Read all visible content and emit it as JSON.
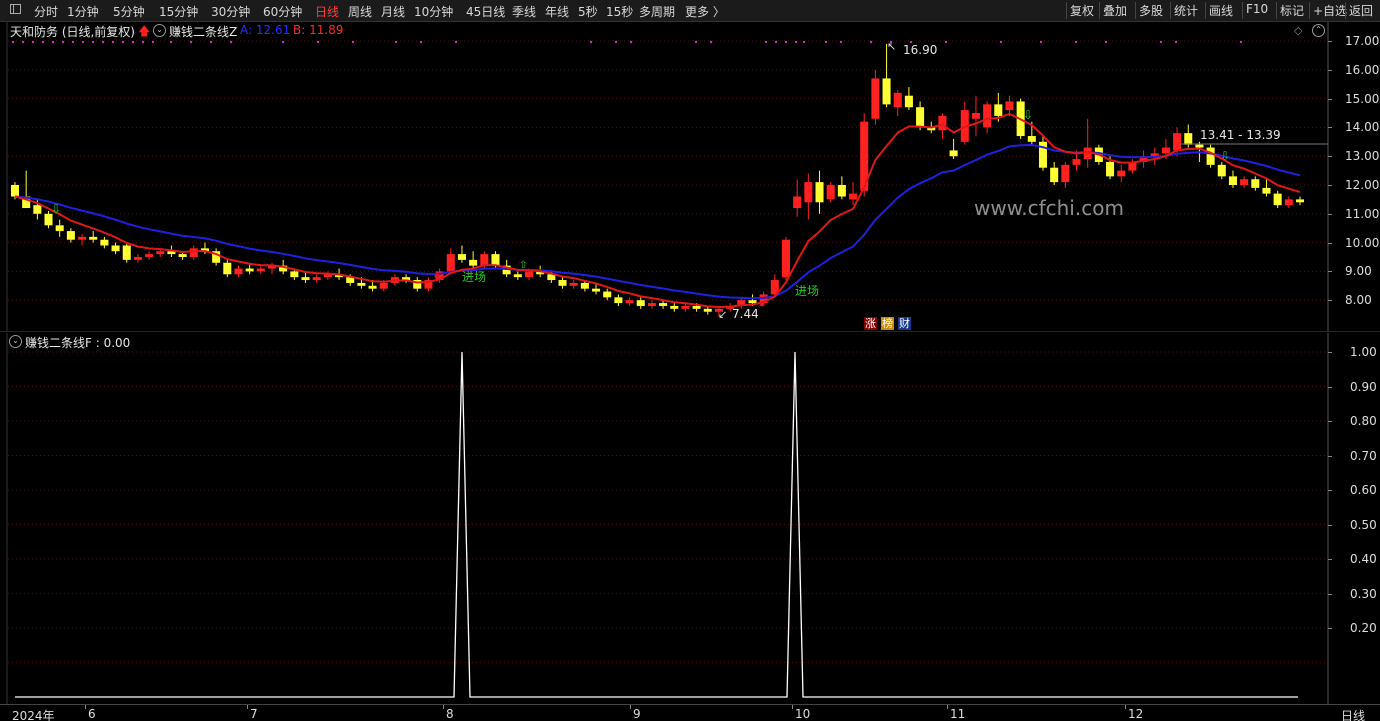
{
  "toolbar": {
    "periods": [
      "分时",
      "1分钟",
      "5分钟",
      "15分钟",
      "30分钟",
      "60分钟",
      "日线",
      "周线",
      "月线",
      "10分钟",
      "45日线",
      "季线",
      "年线",
      "5秒",
      "15秒",
      "多周期",
      "更多 〉"
    ],
    "active_period": "日线",
    "right_buttons": [
      "复权",
      "叠加",
      "多股",
      "统计",
      "画线",
      "F10",
      "标记",
      "+自选",
      "返回"
    ]
  },
  "main_header": {
    "stock_title": "天和防务 (日线,前复权)",
    "indicator_name": "赚钱二条线Z",
    "a_label": "A: 12.61",
    "b_label": "B: 11.89"
  },
  "sub_header": {
    "indicator_label": "赚钱二条线F : 0.00"
  },
  "annotations": {
    "high_label": "16.90",
    "low_label": "7.44",
    "range_label": "13.41 - 13.39",
    "entry_label_1": "进场",
    "entry_label_2": "进场",
    "watermark": "www.cfchi.com",
    "badge_1": "涨",
    "badge_2": "榜",
    "badge_3": "财"
  },
  "price_axis": [
    "17.00",
    "16.00",
    "15.00",
    "14.00",
    "13.00",
    "12.00",
    "11.00",
    "10.00",
    "9.00",
    "8.00"
  ],
  "indicator_axis": [
    "1.00",
    "0.90",
    "0.80",
    "0.70",
    "0.60",
    "0.50",
    "0.40",
    "0.30",
    "0.20"
  ],
  "date_axis": {
    "year_label": "2024年",
    "months": [
      "6",
      "7",
      "8",
      "9",
      "10",
      "11",
      "12"
    ],
    "period_label": "日线"
  },
  "colors": {
    "up_candle": "#ff2020",
    "down_candle": "#ffff33",
    "line_a": "#2020e0",
    "line_b": "#e01818",
    "signal_line": "#ffffff",
    "entry_text": "#22cc22",
    "marker_dots": "#cc33cc",
    "grid": "#3a0c0c"
  },
  "chart_data": [
    {
      "type": "candlestick",
      "title": "天和防务 (日线,前复权)",
      "series": [
        {
          "name": "A",
          "last": 12.61
        },
        {
          "name": "B",
          "last": 11.89
        }
      ],
      "ylim": [
        7.4,
        17.2
      ],
      "high": 16.9,
      "low": 7.44,
      "x_months": [
        "6",
        "7",
        "8",
        "9",
        "10",
        "11",
        "12"
      ],
      "candles_ohlc": [
        [
          12.0,
          12.1,
          11.5,
          11.6
        ],
        [
          11.6,
          12.5,
          11.4,
          11.2
        ],
        [
          11.3,
          11.5,
          10.8,
          11.0
        ],
        [
          11.0,
          11.1,
          10.5,
          10.6
        ],
        [
          10.6,
          10.8,
          10.2,
          10.4
        ],
        [
          10.4,
          10.5,
          10.0,
          10.1
        ],
        [
          10.1,
          10.3,
          9.9,
          10.2
        ],
        [
          10.2,
          10.4,
          10.0,
          10.1
        ],
        [
          10.1,
          10.2,
          9.8,
          9.9
        ],
        [
          9.9,
          10.0,
          9.6,
          9.7
        ],
        [
          9.9,
          10.0,
          9.3,
          9.4
        ],
        [
          9.4,
          9.6,
          9.3,
          9.5
        ],
        [
          9.5,
          9.7,
          9.4,
          9.6
        ],
        [
          9.6,
          9.8,
          9.5,
          9.7
        ],
        [
          9.7,
          9.9,
          9.5,
          9.6
        ],
        [
          9.6,
          9.7,
          9.4,
          9.5
        ],
        [
          9.5,
          9.9,
          9.4,
          9.8
        ],
        [
          9.8,
          10.0,
          9.6,
          9.7
        ],
        [
          9.7,
          9.8,
          9.2,
          9.3
        ],
        [
          9.3,
          9.4,
          8.8,
          8.9
        ],
        [
          8.9,
          9.2,
          8.8,
          9.1
        ],
        [
          9.1,
          9.3,
          8.9,
          9.0
        ],
        [
          9.0,
          9.2,
          8.9,
          9.1
        ],
        [
          9.1,
          9.3,
          8.9,
          9.2
        ],
        [
          9.2,
          9.4,
          8.9,
          9.0
        ],
        [
          9.0,
          9.1,
          8.7,
          8.8
        ],
        [
          8.8,
          9.0,
          8.6,
          8.7
        ],
        [
          8.7,
          8.9,
          8.6,
          8.8
        ],
        [
          8.8,
          9.0,
          8.7,
          8.9
        ],
        [
          8.9,
          9.1,
          8.7,
          8.8
        ],
        [
          8.8,
          8.9,
          8.5,
          8.6
        ],
        [
          8.6,
          8.8,
          8.4,
          8.5
        ],
        [
          8.5,
          8.7,
          8.3,
          8.4
        ],
        [
          8.4,
          8.7,
          8.3,
          8.6
        ],
        [
          8.6,
          8.9,
          8.5,
          8.8
        ],
        [
          8.8,
          8.9,
          8.6,
          8.7
        ],
        [
          8.7,
          8.8,
          8.3,
          8.4
        ],
        [
          8.4,
          8.8,
          8.3,
          8.7
        ],
        [
          8.7,
          9.1,
          8.6,
          9.0
        ],
        [
          9.0,
          9.8,
          8.9,
          9.6
        ],
        [
          9.6,
          9.9,
          9.3,
          9.4
        ],
        [
          9.4,
          9.7,
          9.1,
          9.2
        ],
        [
          9.2,
          9.7,
          9.1,
          9.6
        ],
        [
          9.6,
          9.7,
          9.1,
          9.2
        ],
        [
          9.2,
          9.4,
          8.8,
          8.9
        ],
        [
          8.9,
          9.0,
          8.7,
          8.8
        ],
        [
          8.8,
          9.1,
          8.7,
          9.0
        ],
        [
          9.0,
          9.2,
          8.8,
          8.9
        ],
        [
          8.9,
          9.0,
          8.6,
          8.7
        ],
        [
          8.7,
          8.8,
          8.4,
          8.5
        ],
        [
          8.5,
          8.7,
          8.4,
          8.6
        ],
        [
          8.6,
          8.7,
          8.3,
          8.4
        ],
        [
          8.4,
          8.6,
          8.2,
          8.3
        ],
        [
          8.3,
          8.4,
          8.0,
          8.1
        ],
        [
          8.1,
          8.2,
          7.8,
          7.9
        ],
        [
          7.9,
          8.1,
          7.8,
          8.0
        ],
        [
          8.0,
          8.1,
          7.7,
          7.8
        ],
        [
          7.8,
          8.0,
          7.7,
          7.9
        ],
        [
          7.9,
          8.0,
          7.7,
          7.8
        ],
        [
          7.8,
          7.9,
          7.6,
          7.7
        ],
        [
          7.7,
          7.9,
          7.6,
          7.8
        ],
        [
          7.8,
          7.9,
          7.6,
          7.7
        ],
        [
          7.7,
          7.8,
          7.5,
          7.6
        ],
        [
          7.6,
          7.8,
          7.44,
          7.7
        ],
        [
          7.7,
          7.9,
          7.6,
          7.8
        ],
        [
          7.8,
          8.1,
          7.7,
          8.0
        ],
        [
          8.0,
          8.2,
          7.8,
          7.9
        ],
        [
          7.9,
          8.3,
          7.8,
          8.2
        ],
        [
          8.2,
          8.9,
          8.1,
          8.7
        ],
        [
          8.8,
          10.2,
          8.7,
          10.1
        ],
        [
          11.2,
          12.2,
          10.9,
          11.6
        ],
        [
          11.4,
          12.4,
          10.8,
          12.1
        ],
        [
          12.1,
          12.5,
          11.0,
          11.4
        ],
        [
          11.5,
          12.1,
          11.4,
          12.0
        ],
        [
          12.0,
          12.3,
          11.5,
          11.6
        ],
        [
          11.5,
          12.1,
          11.3,
          11.7
        ],
        [
          11.8,
          14.5,
          11.6,
          14.2
        ],
        [
          14.3,
          16.0,
          14.1,
          15.7
        ],
        [
          15.7,
          16.9,
          14.7,
          14.8
        ],
        [
          14.7,
          15.3,
          14.4,
          15.2
        ],
        [
          15.1,
          15.4,
          14.6,
          14.7
        ],
        [
          14.7,
          14.9,
          13.9,
          14.0
        ],
        [
          14.0,
          14.2,
          13.8,
          13.9
        ],
        [
          13.9,
          14.5,
          13.6,
          14.4
        ],
        [
          13.2,
          13.6,
          12.9,
          13.0
        ],
        [
          13.5,
          14.9,
          13.4,
          14.6
        ],
        [
          14.3,
          15.1,
          13.7,
          14.5
        ],
        [
          14.0,
          14.9,
          13.8,
          14.8
        ],
        [
          14.8,
          15.2,
          14.2,
          14.4
        ],
        [
          14.6,
          15.1,
          14.4,
          14.9
        ],
        [
          14.9,
          15.0,
          13.6,
          13.7
        ],
        [
          13.7,
          14.2,
          13.4,
          13.5
        ],
        [
          13.5,
          13.7,
          12.5,
          12.6
        ],
        [
          12.6,
          12.8,
          12.0,
          12.1
        ],
        [
          12.1,
          12.8,
          11.9,
          12.7
        ],
        [
          12.7,
          13.2,
          12.5,
          12.9
        ],
        [
          12.9,
          14.3,
          12.6,
          13.3
        ],
        [
          13.3,
          13.4,
          12.7,
          12.8
        ],
        [
          12.8,
          13.0,
          12.2,
          12.3
        ],
        [
          12.3,
          12.7,
          12.1,
          12.5
        ],
        [
          12.5,
          12.9,
          12.4,
          12.8
        ],
        [
          12.8,
          13.2,
          12.6,
          13.0
        ],
        [
          13.0,
          13.3,
          12.7,
          13.1
        ],
        [
          13.1,
          13.6,
          12.9,
          13.3
        ],
        [
          13.2,
          14.0,
          13.0,
          13.8
        ],
        [
          13.8,
          14.1,
          13.3,
          13.4
        ],
        [
          13.4,
          13.5,
          12.8,
          13.3
        ],
        [
          13.3,
          13.4,
          12.6,
          12.7
        ],
        [
          12.7,
          12.8,
          12.2,
          12.3
        ],
        [
          12.3,
          12.5,
          11.9,
          12.0
        ],
        [
          12.0,
          12.3,
          11.9,
          12.2
        ],
        [
          12.2,
          12.3,
          11.8,
          11.9
        ],
        [
          11.9,
          12.2,
          11.6,
          11.7
        ],
        [
          11.7,
          11.8,
          11.2,
          11.3
        ],
        [
          11.3,
          11.6,
          11.2,
          11.5
        ],
        [
          11.5,
          11.6,
          11.3,
          11.4
        ]
      ]
    },
    {
      "type": "line",
      "title": "赚钱二条线F",
      "ylim": [
        0,
        1.05
      ],
      "current_value": 0.0,
      "spikes": [
        {
          "near_month": "8",
          "value": 1.0
        },
        {
          "near_month": "10",
          "value": 1.0
        }
      ]
    }
  ]
}
